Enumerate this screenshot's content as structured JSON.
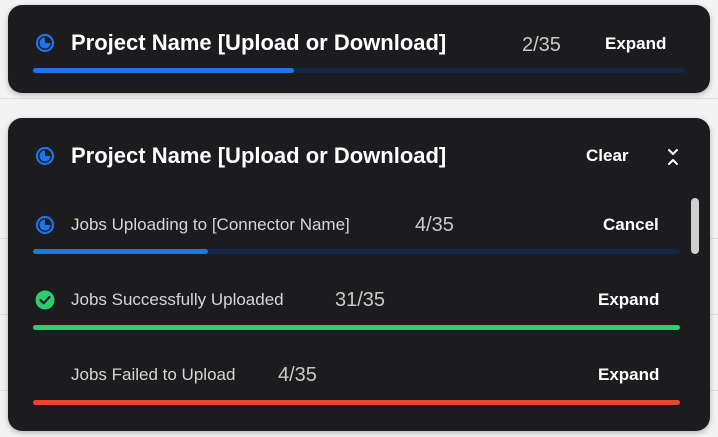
{
  "colors": {
    "accent_blue": "#1f74ea",
    "track_blue": "#14254a",
    "success_green": "#2ecc71",
    "error_red": "#e8472e"
  },
  "collapsed_panel": {
    "title": "Project Name [Upload or Download]",
    "count": "2/35",
    "expand_label": "Expand",
    "icon": "progress-spinner-icon",
    "progress": 0.4
  },
  "expanded_panel": {
    "title": "Project Name [Upload or Download]",
    "clear_label": "Clear",
    "collapse_icon": "collapse-chevrons-icon",
    "icon": "progress-spinner-icon",
    "jobs": [
      {
        "label": "Jobs Uploading to [Connector Name]",
        "count": "4/35",
        "action": "Cancel",
        "icon": "progress-spinner-icon",
        "progress": 0.27,
        "status": "uploading"
      },
      {
        "label": "Jobs Successfully Uploaded",
        "count": "31/35",
        "action": "Expand",
        "icon": "check-circle-icon",
        "progress": 1.0,
        "status": "success"
      },
      {
        "label": "Jobs Failed to Upload",
        "count": "4/35",
        "action": "Expand",
        "icon": "",
        "progress": 1.0,
        "status": "failed"
      }
    ]
  }
}
